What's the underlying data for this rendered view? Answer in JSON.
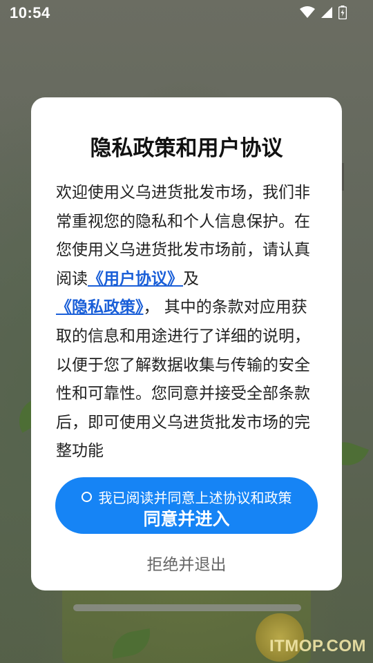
{
  "status_bar": {
    "time": "10:54",
    "icons": [
      "wifi-icon",
      "signal-icon",
      "battery-icon"
    ]
  },
  "dialog": {
    "title": "隐私政策和用户协议",
    "body_part1": "欢迎使用义乌进货批发市场，我们非常重视您的隐私和个人信息保护。在您使用义乌进货批发市场前，请认真阅读",
    "link_user_agreement": "《用户协议》",
    "conjunction": "及",
    "link_privacy_policy": "《隐私政策》",
    "body_part2": "， 其中的条款对应用获取的信息和用途进行了详细的说明，以便于您了解数据收集与传输的安全性和可靠性。您同意并接受全部条款后，即可使用义乌进货批发市场的完整功能",
    "checkbox_label": "我已阅读并同意上述协议和政策",
    "agree_button": "同意并进入",
    "reject_button": "拒绝并退出"
  },
  "colors": {
    "accent": "#1684f5",
    "link": "#1a5fd8"
  },
  "watermark": "ITMOP.COM"
}
